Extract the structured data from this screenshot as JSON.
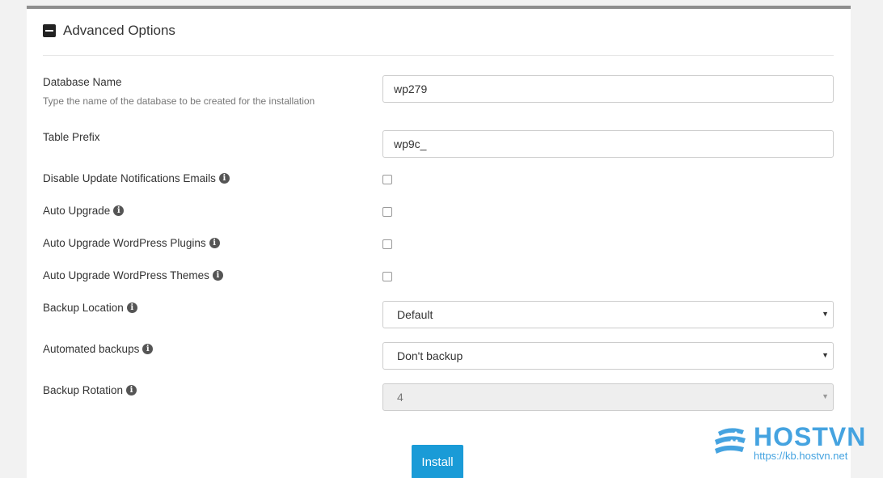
{
  "section": {
    "title": "Advanced Options"
  },
  "fields": {
    "database_name": {
      "label": "Database Name",
      "help": "Type the name of the database to be created for the installation",
      "value": "wp279"
    },
    "table_prefix": {
      "label": "Table Prefix",
      "value": "wp9c_"
    },
    "disable_update_emails": {
      "label": "Disable Update Notifications Emails",
      "checked": false
    },
    "auto_upgrade": {
      "label": "Auto Upgrade",
      "checked": false
    },
    "auto_upgrade_plugins": {
      "label": "Auto Upgrade WordPress Plugins",
      "checked": false
    },
    "auto_upgrade_themes": {
      "label": "Auto Upgrade WordPress Themes",
      "checked": false
    },
    "backup_location": {
      "label": "Backup Location",
      "selected": "Default"
    },
    "automated_backups": {
      "label": "Automated backups",
      "selected": "Don't backup"
    },
    "backup_rotation": {
      "label": "Backup Rotation",
      "selected": "4",
      "disabled": true
    }
  },
  "install_button": {
    "label": "Install"
  },
  "watermark": {
    "brand": "HOSTVN",
    "url": "https://kb.hostvn.net"
  },
  "icons": {
    "collapse": "minus-square-icon",
    "info": "info-circle-icon",
    "dropdown": "caret-down-icon"
  },
  "colors": {
    "accent": "#1a9bd7",
    "brand": "#45a3e0",
    "panel_border": "#8e8e8e"
  }
}
